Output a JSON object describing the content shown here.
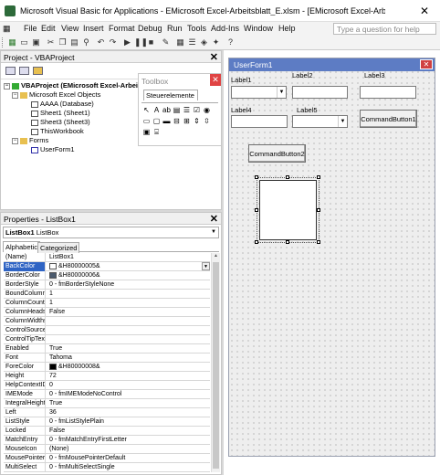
{
  "window": {
    "title": "Microsoft Visual Basic for Applications - EMicrosoft Excel-Arbeitsblatt_E.xlsm - [EMicrosoft Excel-Arbeitsblatt_E.xlsm - U...",
    "close_glyph": "✕"
  },
  "menu": {
    "items": [
      "File",
      "Edit",
      "View",
      "Insert",
      "Format",
      "Debug",
      "Run",
      "Tools",
      "Add-Ins",
      "Window",
      "Help"
    ],
    "ask_placeholder": "Type a question for help"
  },
  "project": {
    "title": "Project - VBAProject",
    "tree": [
      {
        "label": "VBAProject (EMicrosoft Excel-Arbeitsbl",
        "icon": "vba-icon"
      },
      {
        "label": "Microsoft Excel Objects",
        "icon": "folder-icon"
      },
      {
        "label": "AAAA (Database)",
        "icon": "sheet-icon"
      },
      {
        "label": "Sheet1 (Sheet1)",
        "icon": "sheet-icon"
      },
      {
        "label": "Sheet3 (Sheet3)",
        "icon": "sheet-icon"
      },
      {
        "label": "ThisWorkbook",
        "icon": "sheet-icon"
      },
      {
        "label": "Forms",
        "icon": "folder-icon"
      },
      {
        "label": "UserForm1",
        "icon": "form-icon"
      }
    ]
  },
  "toolbox": {
    "title": "Toolbox",
    "tab": "Steuerelemente"
  },
  "properties": {
    "title": "Properties - ListBox1",
    "object_name": "ListBox1",
    "object_type": "ListBox",
    "tabs": [
      "Alphabetic",
      "Categorized"
    ],
    "rows": [
      {
        "name": "(Name)",
        "value": "ListBox1"
      },
      {
        "name": "BackColor",
        "value": "&H80000005&",
        "swatch": "#ffffff",
        "selected": true
      },
      {
        "name": "BorderColor",
        "value": "&H80000006&",
        "swatch": "#4b5b6e"
      },
      {
        "name": "BorderStyle",
        "value": "0 - fmBorderStyleNone"
      },
      {
        "name": "BoundColumn",
        "value": "1"
      },
      {
        "name": "ColumnCount",
        "value": "1"
      },
      {
        "name": "ColumnHeads",
        "value": "False"
      },
      {
        "name": "ColumnWidths",
        "value": ""
      },
      {
        "name": "ControlSource",
        "value": ""
      },
      {
        "name": "ControlTipText",
        "value": ""
      },
      {
        "name": "Enabled",
        "value": "True"
      },
      {
        "name": "Font",
        "value": "Tahoma"
      },
      {
        "name": "ForeColor",
        "value": "&H80000008&",
        "swatch": "#000000"
      },
      {
        "name": "Height",
        "value": "72"
      },
      {
        "name": "HelpContextID",
        "value": "0"
      },
      {
        "name": "IMEMode",
        "value": "0 - fmIMEModeNoControl"
      },
      {
        "name": "IntegralHeight",
        "value": "True"
      },
      {
        "name": "Left",
        "value": "36"
      },
      {
        "name": "ListStyle",
        "value": "0 - fmListStylePlain"
      },
      {
        "name": "Locked",
        "value": "False"
      },
      {
        "name": "MatchEntry",
        "value": "0 - fmMatchEntryFirstLetter"
      },
      {
        "name": "MouseIcon",
        "value": "(None)"
      },
      {
        "name": "MousePointer",
        "value": "0 - fmMousePointerDefault"
      },
      {
        "name": "MultiSelect",
        "value": "0 - fmMultiSelectSingle"
      }
    ]
  },
  "userform": {
    "caption": "UserForm1",
    "labels": {
      "label1": "Label1",
      "label2": "Label2",
      "label3": "Label3",
      "label4": "Label4",
      "label5": "Label5"
    },
    "buttons": {
      "cmd1": "CommandButton1",
      "cmd2": "CommandButton2"
    }
  }
}
